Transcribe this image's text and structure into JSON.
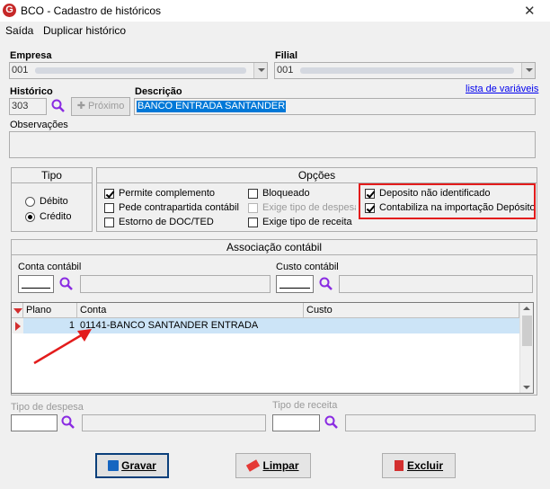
{
  "window": {
    "title": "BCO - Cadastro de históricos",
    "icon": "G"
  },
  "menu": [
    "Saída",
    "Duplicar histórico"
  ],
  "empresa": {
    "label": "Empresa",
    "value": "001"
  },
  "filial": {
    "label": "Filial",
    "value": "001"
  },
  "historico": {
    "label": "Histórico",
    "value": "303",
    "proximo_label": "Próximo"
  },
  "descricao": {
    "label": "Descrição",
    "value": "BANCO ENTRADA SANTANDER"
  },
  "lista_variaveis": "lista de variáveis",
  "observacoes": {
    "label": "Observações",
    "value": ""
  },
  "tipo": {
    "title": "Tipo",
    "options": [
      {
        "label": "Débito",
        "checked": false
      },
      {
        "label": "Crédito",
        "checked": true
      }
    ]
  },
  "opcoes": {
    "title": "Opções",
    "items": [
      {
        "label": "Permite complemento",
        "checked": true,
        "enabled": true
      },
      {
        "label": "Pede contrapartida contábil",
        "checked": false,
        "enabled": true
      },
      {
        "label": "Estorno de DOC/TED",
        "checked": false,
        "enabled": true
      },
      {
        "label": "Bloqueado",
        "checked": false,
        "enabled": true
      },
      {
        "label": "Exige tipo de despesa",
        "checked": false,
        "enabled": false
      },
      {
        "label": "Exige tipo de receita",
        "checked": false,
        "enabled": true
      },
      {
        "label": "Deposito não identificado",
        "checked": true,
        "enabled": true
      },
      {
        "label": "Contabiliza na importação Depósito",
        "checked": true,
        "enabled": true
      }
    ]
  },
  "associacao": {
    "title": "Associação contábil",
    "conta_label": "Conta contábil",
    "custo_label": "Custo contábil",
    "columns": [
      "Plano",
      "Conta",
      "Custo"
    ],
    "rows": [
      {
        "plano": "1",
        "conta": "01141-BANCO SANTANDER ENTRADA",
        "custo": ""
      }
    ]
  },
  "tipo_despesa": {
    "label": "Tipo de despesa"
  },
  "tipo_receita": {
    "label": "Tipo de receita"
  },
  "buttons": {
    "gravar": "Gravar",
    "limpar": "Limpar",
    "excluir": "Excluir"
  },
  "colors": {
    "highlight": "#e31c1c",
    "selection": "#0078d7",
    "link": "#0000ee"
  }
}
